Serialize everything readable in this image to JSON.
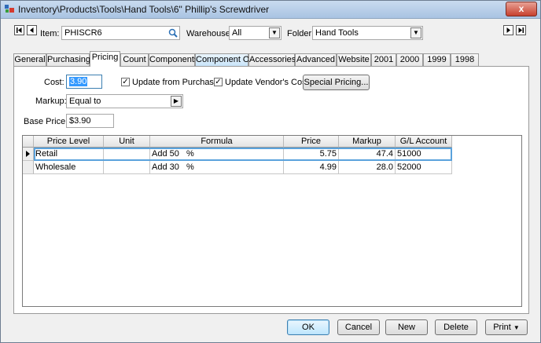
{
  "window": {
    "title": "Inventory\\Products\\Tools\\Hand Tools\\6\" Phillip's Screwdriver",
    "close_glyph": "x"
  },
  "top": {
    "item_label": "Item:",
    "item_value": "PHISCR6",
    "warehouse_label": "Warehouse:",
    "warehouse_value": "All",
    "folder_label": "Folder:",
    "folder_value": "Hand Tools"
  },
  "tabs": [
    "General",
    "Purchasing",
    "Pricing",
    "Count",
    "Components",
    "Component Of",
    "Accessories",
    "Advanced",
    "Website",
    "2001",
    "2000",
    "1999",
    "1998"
  ],
  "active_tab": "Pricing",
  "pricing": {
    "cost_label": "Cost:",
    "cost_value": "3.90",
    "update_purchases_label": "Update from Purchases",
    "update_purchases_checked": true,
    "update_vendor_label": "Update Vendor's Cost",
    "update_vendor_checked": true,
    "special_pricing_label": "Special Pricing...",
    "markup_label": "Markup:",
    "markup_value": "Equal to",
    "base_price_label": "Base Price:",
    "base_price_value": "$3.90"
  },
  "grid": {
    "columns": [
      "Price Level",
      "Unit",
      "Formula",
      "Price",
      "Markup",
      "G/L Account"
    ],
    "rows": [
      {
        "price_level": "Retail",
        "unit": "",
        "formula_prefix": "Add 50",
        "formula_suffix": "%",
        "price": "5.75",
        "markup": "47.4",
        "gl_account": "51000"
      },
      {
        "price_level": "Wholesale",
        "unit": "",
        "formula_prefix": "Add 30",
        "formula_suffix": "%",
        "price": "4.99",
        "markup": "28.0",
        "gl_account": "52000"
      }
    ]
  },
  "buttons": {
    "ok": "OK",
    "cancel": "Cancel",
    "new": "New",
    "delete": "Delete",
    "print": "Print"
  },
  "colors": {
    "accent": "#3c7fb1",
    "close": "#c7412f",
    "selection": "#3399ff"
  }
}
